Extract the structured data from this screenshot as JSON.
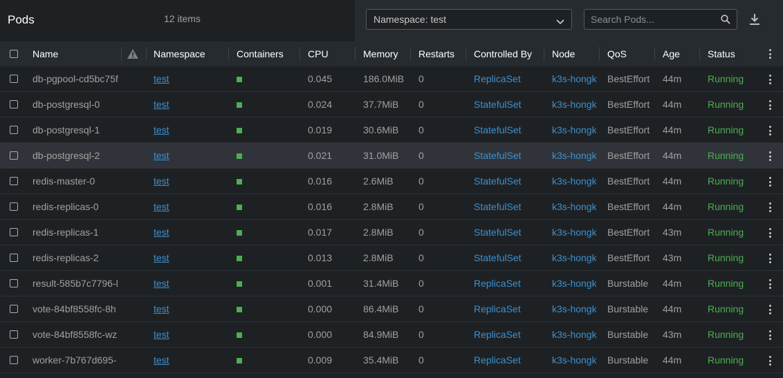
{
  "header": {
    "title": "Pods",
    "count": "12 items",
    "namespace_select": "Namespace: test",
    "search_placeholder": "Search Pods..."
  },
  "columns": {
    "name": "Name",
    "namespace": "Namespace",
    "containers": "Containers",
    "cpu": "CPU",
    "memory": "Memory",
    "restarts": "Restarts",
    "controlled_by": "Controlled By",
    "node": "Node",
    "qos": "QoS",
    "age": "Age",
    "status": "Status"
  },
  "colors": {
    "link": "#3d90ce",
    "running": "#4caf50",
    "container_ok": "#4caf50"
  },
  "rows": [
    {
      "name": "db-pgpool-cd5bc75f",
      "namespace": "test",
      "cpu": "0.045",
      "memory": "186.0MiB",
      "restarts": "0",
      "controlled_by": "ReplicaSet",
      "node": "k3s-hongk",
      "qos": "BestEffort",
      "age": "44m",
      "status": "Running"
    },
    {
      "name": "db-postgresql-0",
      "namespace": "test",
      "cpu": "0.024",
      "memory": "37.7MiB",
      "restarts": "0",
      "controlled_by": "StatefulSet",
      "node": "k3s-hongk",
      "qos": "BestEffort",
      "age": "44m",
      "status": "Running"
    },
    {
      "name": "db-postgresql-1",
      "namespace": "test",
      "cpu": "0.019",
      "memory": "30.6MiB",
      "restarts": "0",
      "controlled_by": "StatefulSet",
      "node": "k3s-hongk",
      "qos": "BestEffort",
      "age": "44m",
      "status": "Running"
    },
    {
      "name": "db-postgresql-2",
      "namespace": "test",
      "cpu": "0.021",
      "memory": "31.0MiB",
      "restarts": "0",
      "controlled_by": "StatefulSet",
      "node": "k3s-hongk",
      "qos": "BestEffort",
      "age": "44m",
      "status": "Running"
    },
    {
      "name": "redis-master-0",
      "namespace": "test",
      "cpu": "0.016",
      "memory": "2.6MiB",
      "restarts": "0",
      "controlled_by": "StatefulSet",
      "node": "k3s-hongk",
      "qos": "BestEffort",
      "age": "44m",
      "status": "Running"
    },
    {
      "name": "redis-replicas-0",
      "namespace": "test",
      "cpu": "0.016",
      "memory": "2.8MiB",
      "restarts": "0",
      "controlled_by": "StatefulSet",
      "node": "k3s-hongk",
      "qos": "BestEffort",
      "age": "44m",
      "status": "Running"
    },
    {
      "name": "redis-replicas-1",
      "namespace": "test",
      "cpu": "0.017",
      "memory": "2.8MiB",
      "restarts": "0",
      "controlled_by": "StatefulSet",
      "node": "k3s-hongk",
      "qos": "BestEffort",
      "age": "43m",
      "status": "Running"
    },
    {
      "name": "redis-replicas-2",
      "namespace": "test",
      "cpu": "0.013",
      "memory": "2.8MiB",
      "restarts": "0",
      "controlled_by": "StatefulSet",
      "node": "k3s-hongk",
      "qos": "BestEffort",
      "age": "43m",
      "status": "Running"
    },
    {
      "name": "result-585b7c7796-l",
      "namespace": "test",
      "cpu": "0.001",
      "memory": "31.4MiB",
      "restarts": "0",
      "controlled_by": "ReplicaSet",
      "node": "k3s-hongk",
      "qos": "Burstable",
      "age": "44m",
      "status": "Running"
    },
    {
      "name": "vote-84bf8558fc-8h",
      "namespace": "test",
      "cpu": "0.000",
      "memory": "86.4MiB",
      "restarts": "0",
      "controlled_by": "ReplicaSet",
      "node": "k3s-hongk",
      "qos": "Burstable",
      "age": "44m",
      "status": "Running"
    },
    {
      "name": "vote-84bf8558fc-wz",
      "namespace": "test",
      "cpu": "0.000",
      "memory": "84.9MiB",
      "restarts": "0",
      "controlled_by": "ReplicaSet",
      "node": "k3s-hongk",
      "qos": "Burstable",
      "age": "43m",
      "status": "Running"
    },
    {
      "name": "worker-7b767d695-",
      "namespace": "test",
      "cpu": "0.009",
      "memory": "35.4MiB",
      "restarts": "0",
      "controlled_by": "ReplicaSet",
      "node": "k3s-hongk",
      "qos": "Burstable",
      "age": "44m",
      "status": "Running"
    }
  ],
  "highlighted_row": 3
}
